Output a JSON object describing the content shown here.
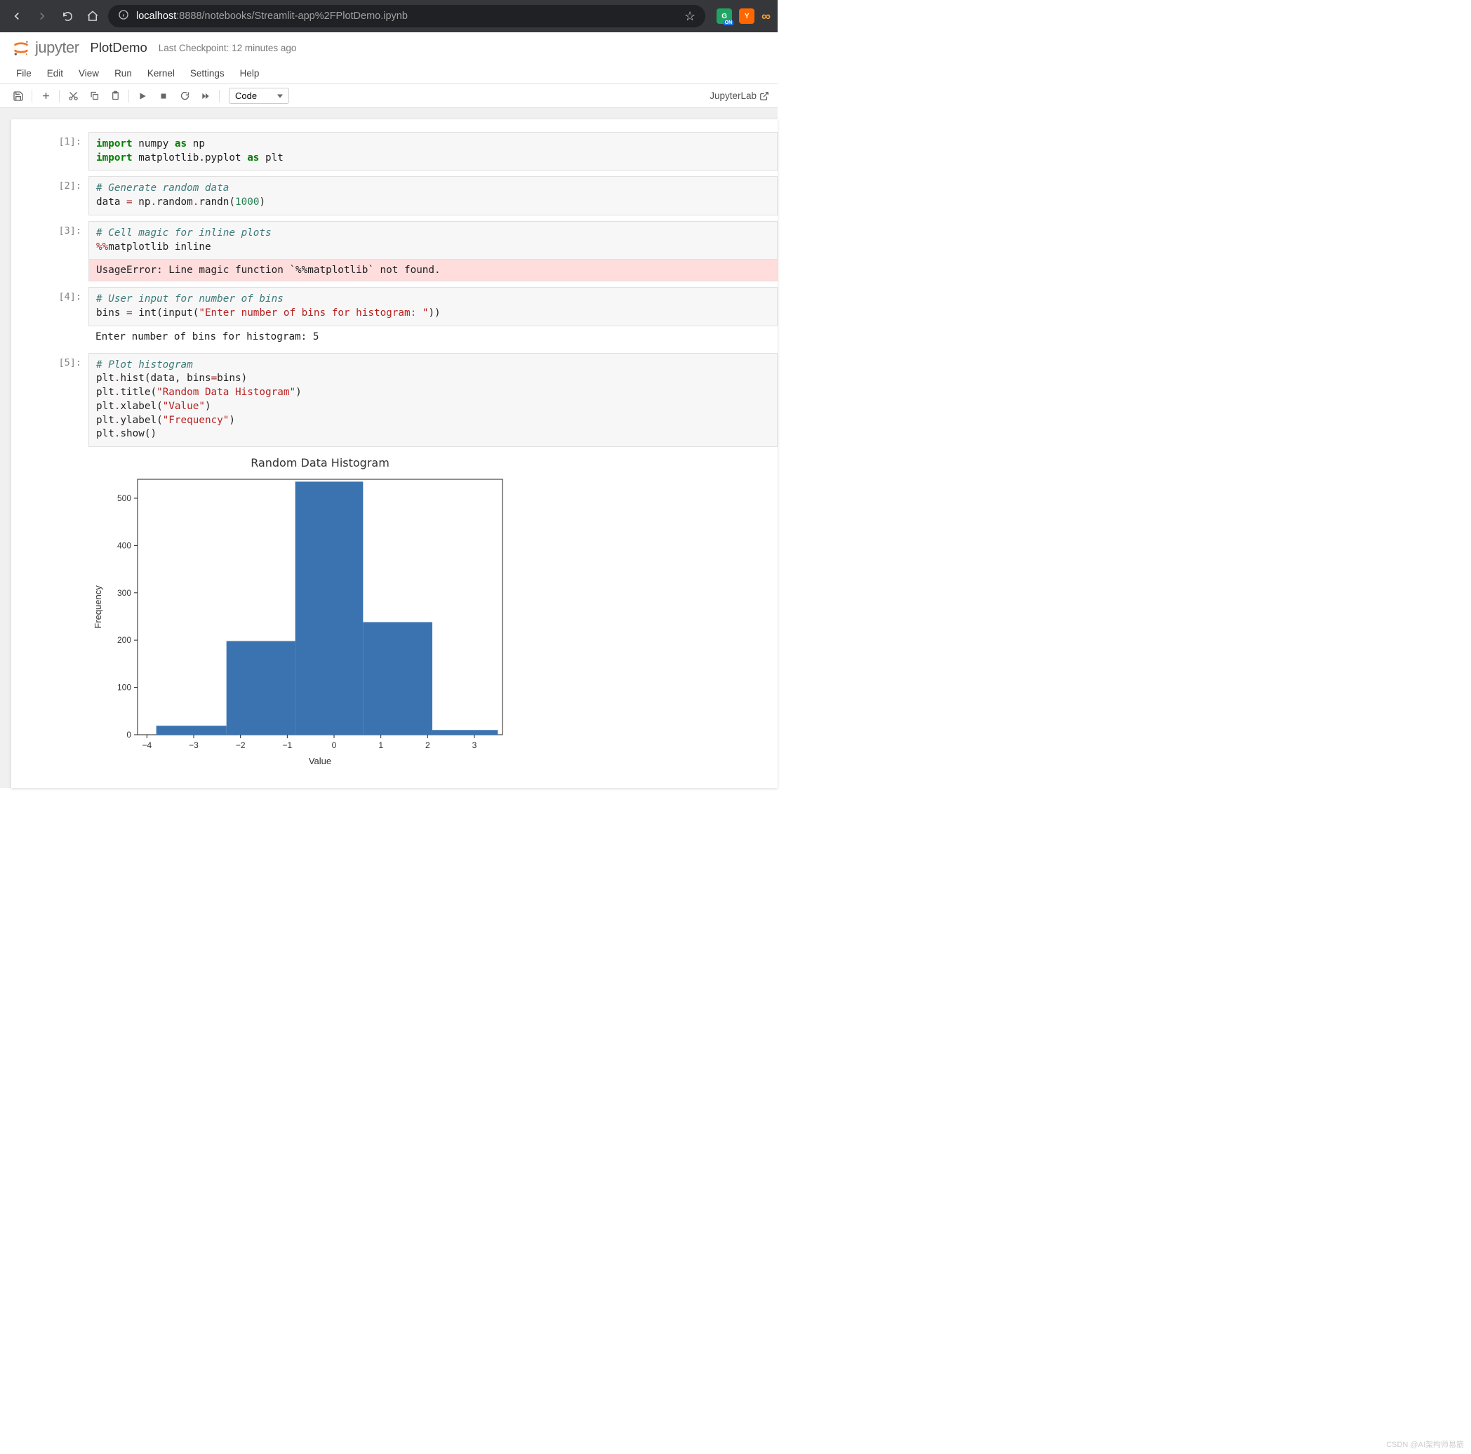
{
  "browser": {
    "url_host": "localhost",
    "url_port": ":8888",
    "url_path": "/notebooks/Streamlit-app%2FPlotDemo.ipynb",
    "ext_on": "ON",
    "ext_y": "Y",
    "ext_loop": "∞",
    "star": "☆"
  },
  "header": {
    "logo_text": "jupyter",
    "notebook_title": "PlotDemo",
    "checkpoint": "Last Checkpoint: 12 minutes ago"
  },
  "menubar": [
    "File",
    "Edit",
    "View",
    "Run",
    "Kernel",
    "Settings",
    "Help"
  ],
  "toolbar": {
    "cell_type": "Code",
    "jupyterlab": "JupyterLab"
  },
  "cells": [
    {
      "prompt": "[1]:",
      "code_tokens": [
        {
          "c": "kw",
          "t": "import"
        },
        {
          "c": "nm",
          "t": " numpy "
        },
        {
          "c": "kw",
          "t": "as"
        },
        {
          "c": "nm",
          "t": " np\n"
        },
        {
          "c": "kw",
          "t": "import"
        },
        {
          "c": "nm",
          "t": " matplotlib.pyplot "
        },
        {
          "c": "kw",
          "t": "as"
        },
        {
          "c": "nm",
          "t": " plt"
        }
      ]
    },
    {
      "prompt": "[2]:",
      "code_tokens": [
        {
          "c": "cm",
          "t": "# Generate random data"
        },
        {
          "c": "nm",
          "t": "\ndata "
        },
        {
          "c": "op",
          "t": "="
        },
        {
          "c": "nm",
          "t": " np"
        },
        {
          "c": "op",
          "t": "."
        },
        {
          "c": "nm",
          "t": "random"
        },
        {
          "c": "op",
          "t": "."
        },
        {
          "c": "nm",
          "t": "randn("
        },
        {
          "c": "num",
          "t": "1000"
        },
        {
          "c": "nm",
          "t": ")"
        }
      ]
    },
    {
      "prompt": "[3]:",
      "code_tokens": [
        {
          "c": "cm",
          "t": "# Cell magic for inline plots"
        },
        {
          "c": "nm",
          "t": "\n"
        },
        {
          "c": "op",
          "t": "%%"
        },
        {
          "c": "nm",
          "t": "matplotlib inline"
        }
      ],
      "error": "UsageError: Line magic function `%%matplotlib` not found."
    },
    {
      "prompt": "[4]:",
      "code_tokens": [
        {
          "c": "cm",
          "t": "# User input for number of bins"
        },
        {
          "c": "nm",
          "t": "\nbins "
        },
        {
          "c": "op",
          "t": "="
        },
        {
          "c": "nm",
          "t": " int(input("
        },
        {
          "c": "str",
          "t": "\"Enter number of bins for histogram: \""
        },
        {
          "c": "nm",
          "t": "))"
        }
      ],
      "stream": "Enter number of bins for histogram:  5"
    },
    {
      "prompt": "[5]:",
      "code_tokens": [
        {
          "c": "cm",
          "t": "# Plot histogram"
        },
        {
          "c": "nm",
          "t": "\nplt"
        },
        {
          "c": "op",
          "t": "."
        },
        {
          "c": "nm",
          "t": "hist(data, bins"
        },
        {
          "c": "op",
          "t": "="
        },
        {
          "c": "nm",
          "t": "bins)\nplt"
        },
        {
          "c": "op",
          "t": "."
        },
        {
          "c": "nm",
          "t": "title("
        },
        {
          "c": "str",
          "t": "\"Random Data Histogram\""
        },
        {
          "c": "nm",
          "t": ")\nplt"
        },
        {
          "c": "op",
          "t": "."
        },
        {
          "c": "nm",
          "t": "xlabel("
        },
        {
          "c": "str",
          "t": "\"Value\""
        },
        {
          "c": "nm",
          "t": ")\nplt"
        },
        {
          "c": "op",
          "t": "."
        },
        {
          "c": "nm",
          "t": "ylabel("
        },
        {
          "c": "str",
          "t": "\"Frequency\""
        },
        {
          "c": "nm",
          "t": ")\nplt"
        },
        {
          "c": "op",
          "t": "."
        },
        {
          "c": "nm",
          "t": "show()"
        }
      ],
      "has_plot": true
    }
  ],
  "chart_data": {
    "type": "bar",
    "title": "Random Data Histogram",
    "xlabel": "Value",
    "ylabel": "Frequency",
    "xticks": [
      -4,
      -3,
      -2,
      -1,
      0,
      1,
      2,
      3
    ],
    "yticks": [
      0,
      100,
      200,
      300,
      400,
      500
    ],
    "xlim": [
      -4.2,
      3.6
    ],
    "ylim": [
      0,
      540
    ],
    "bin_edges": [
      -3.8,
      -2.3,
      -0.83,
      0.62,
      2.1,
      3.5
    ],
    "values": [
      19,
      198,
      535,
      238,
      10
    ]
  },
  "watermark": "CSDN @AI架构师易筋"
}
